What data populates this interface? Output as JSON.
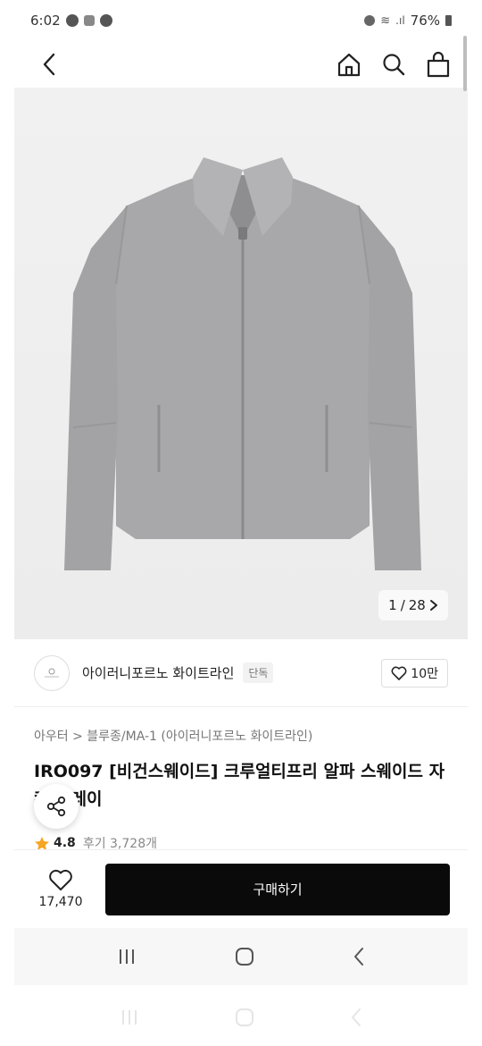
{
  "status": {
    "time": "6:02",
    "battery": "76%"
  },
  "header": {
    "back_icon": "chevron-left-icon",
    "home_icon": "home-icon",
    "search_icon": "search-icon",
    "bag_icon": "shopping-bag-icon"
  },
  "gallery": {
    "current": "1",
    "separator": "/",
    "total": "28",
    "next_icon": "chevron-right-icon"
  },
  "brand": {
    "name": "아이러니포르노 화이트라인",
    "badge": "단독",
    "likes": "10만"
  },
  "product": {
    "breadcrumb": "아우터 > 블루종/MA-1 (아이러니포르노 화이트라인)",
    "title": "IRO097 [비건스웨이드] 크루얼티프리 알파 스웨이드 자켓 그레이",
    "rating": "4.8",
    "review_text": "후기 3,728개"
  },
  "buybar": {
    "wish_count": "17,470",
    "buy_label": "구매하기"
  },
  "colors": {
    "accent": "#0a0a0a",
    "star": "#f5a623",
    "jacket": "#a9a9ab"
  }
}
